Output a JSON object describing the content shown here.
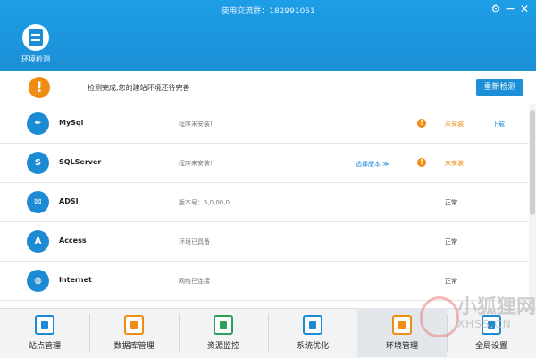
{
  "window": {
    "title": "使用交流群：182991051"
  },
  "top_nav": {
    "env_check_label": "环境检测"
  },
  "status": {
    "message": "检测完成,您的建站环境还待完善",
    "recheck_label": "重新检测"
  },
  "rows": [
    {
      "name": "MySql",
      "info": "程序未安装!",
      "version_link": "",
      "state": "未安装",
      "state_kind": "bad",
      "action": "下载",
      "icon": "feather-icon"
    },
    {
      "name": "SQLServer",
      "info": "程序未安装!",
      "version_link": "选择版本",
      "state": "未安装",
      "state_kind": "bad",
      "action": "",
      "icon": "sqlserver-icon"
    },
    {
      "name": "ADSI",
      "info": "版本号：5,0,00,0",
      "version_link": "",
      "state": "正常",
      "state_kind": "ok",
      "action": "",
      "icon": "adsi-icon"
    },
    {
      "name": "Access",
      "info": "环境已具备",
      "version_link": "",
      "state": "正常",
      "state_kind": "ok",
      "action": "",
      "icon": "access-icon"
    },
    {
      "name": "Internet",
      "info": "网络已连接",
      "version_link": "",
      "state": "正常",
      "state_kind": "ok",
      "action": "",
      "icon": "globe-icon"
    }
  ],
  "tabs": [
    {
      "label": "站点管理",
      "icon": "site-manage-icon"
    },
    {
      "label": "数据库管理",
      "icon": "database-icon"
    },
    {
      "label": "资源监控",
      "icon": "monitor-icon"
    },
    {
      "label": "系统优化",
      "icon": "optimize-icon"
    },
    {
      "label": "环境管理",
      "icon": "env-manage-icon"
    },
    {
      "label": "全局设置",
      "icon": "settings-icon"
    }
  ],
  "watermark": {
    "main": "小狐狸网",
    "sub": "XHSS.CN"
  }
}
